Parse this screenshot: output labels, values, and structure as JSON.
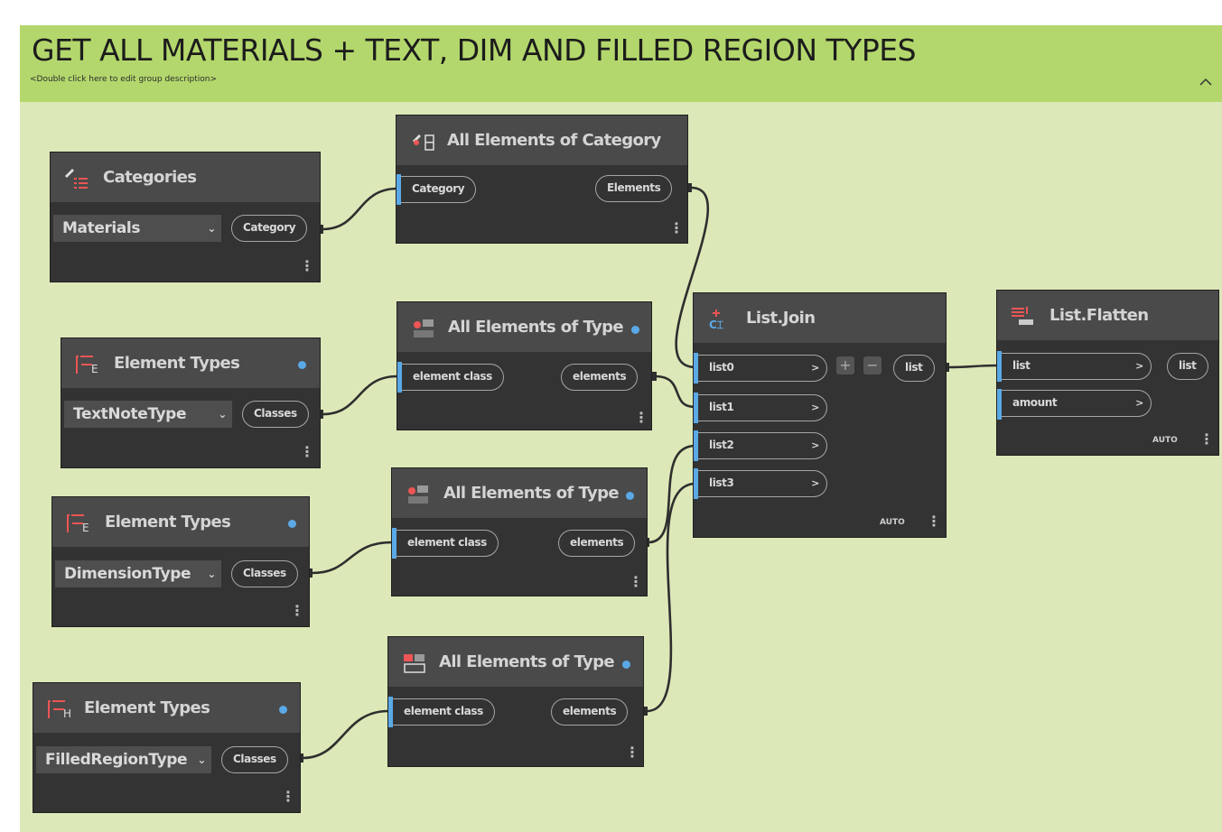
{
  "group": {
    "title": "GET ALL MATERIALS + TEXT, DIM AND FILLED REGION TYPES",
    "description": "<Double click here to edit group description>",
    "collapse_icon": "chevron-up-icon"
  },
  "nodes": {
    "categories": {
      "title": "Categories",
      "value": "Materials",
      "output": "Category"
    },
    "elem_types_1": {
      "title": "Element Types",
      "value": "TextNoteType",
      "output": "Classes"
    },
    "elem_types_2": {
      "title": "Element Types",
      "value": "DimensionType",
      "output": "Classes"
    },
    "elem_types_3": {
      "title": "Element Types",
      "value": "FilledRegionType",
      "output": "Classes"
    },
    "all_of_category": {
      "title": "All Elements of Category",
      "input": "Category",
      "output": "Elements"
    },
    "all_of_type_1": {
      "title": "All Elements of Type",
      "input": "element class",
      "output": "elements"
    },
    "all_of_type_2": {
      "title": "All Elements of Type",
      "input": "element class",
      "output": "elements"
    },
    "all_of_type_3": {
      "title": "All Elements of Type",
      "input": "element class",
      "output": "elements"
    },
    "list_join": {
      "title": "List.Join",
      "inputs": [
        "list0",
        "list1",
        "list2",
        "list3"
      ],
      "output": "list",
      "lacing": "AUTO",
      "add_label": "+",
      "remove_label": "−"
    },
    "list_flatten": {
      "title": "List.Flatten",
      "inputs": [
        "list",
        "amount"
      ],
      "output": "list",
      "lacing": "AUTO"
    }
  },
  "colors": {
    "group_header": "#b3d76c",
    "group_body": "#dce8b8",
    "node_body": "#333333",
    "node_header": "#4a4a4a",
    "port_accent": "#5aa9e6",
    "wire": "#2e2e2e"
  }
}
